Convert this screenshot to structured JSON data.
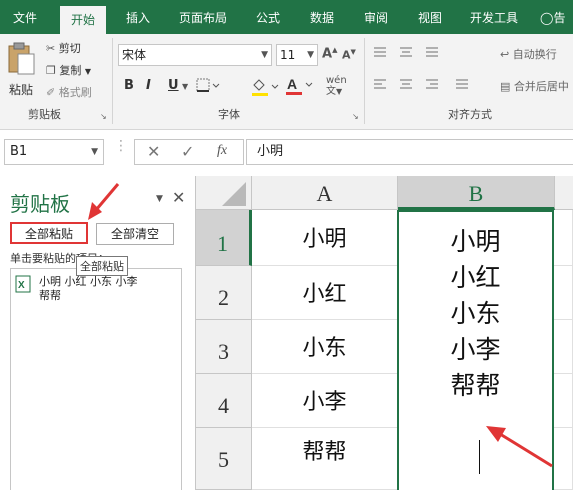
{
  "ribbon_tabs": [
    "文件",
    "开始",
    "插入",
    "页面布局",
    "公式",
    "数据",
    "审阅",
    "视图",
    "开发工具",
    "告"
  ],
  "active_tab": "开始",
  "clipboard_group": {
    "paste_label": "粘贴",
    "cut_label": "剪切",
    "copy_label": "复制",
    "format_painter_label": "格式刷",
    "group_label": "剪贴板"
  },
  "font_group": {
    "font_name": "宋体",
    "font_size": "11",
    "bold": "B",
    "italic": "I",
    "underline": "U",
    "group_label": "字体",
    "font_color": "#e03535"
  },
  "alignment_group": {
    "wrap_text_label": "自动换行",
    "merge_center_label": "合并后居中",
    "group_label": "对齐方式"
  },
  "formula_bar": {
    "name_box": "B1",
    "fx_label": "fx",
    "formula_value": "小明"
  },
  "clipboard_pane": {
    "title": "剪贴板",
    "paste_all_label": "全部粘贴",
    "clear_all_label": "全部清空",
    "instruction": "单击要粘贴的项目：",
    "tooltip": "全部粘贴",
    "item_line1": "小明 小红 小东 小李",
    "item_line2": "帮帮"
  },
  "sheet": {
    "columns": [
      "A",
      "B"
    ],
    "rows": [
      "1",
      "2",
      "3",
      "4",
      "5"
    ],
    "col_a": [
      "小明",
      "小红",
      "小东",
      "小李",
      "帮帮"
    ],
    "b1_lines": [
      "小明",
      "小红",
      "小东",
      "小李",
      "帮帮"
    ],
    "selected_cell": "B1"
  },
  "colors": {
    "accent": "#217346",
    "annotation_red": "#e03535"
  }
}
